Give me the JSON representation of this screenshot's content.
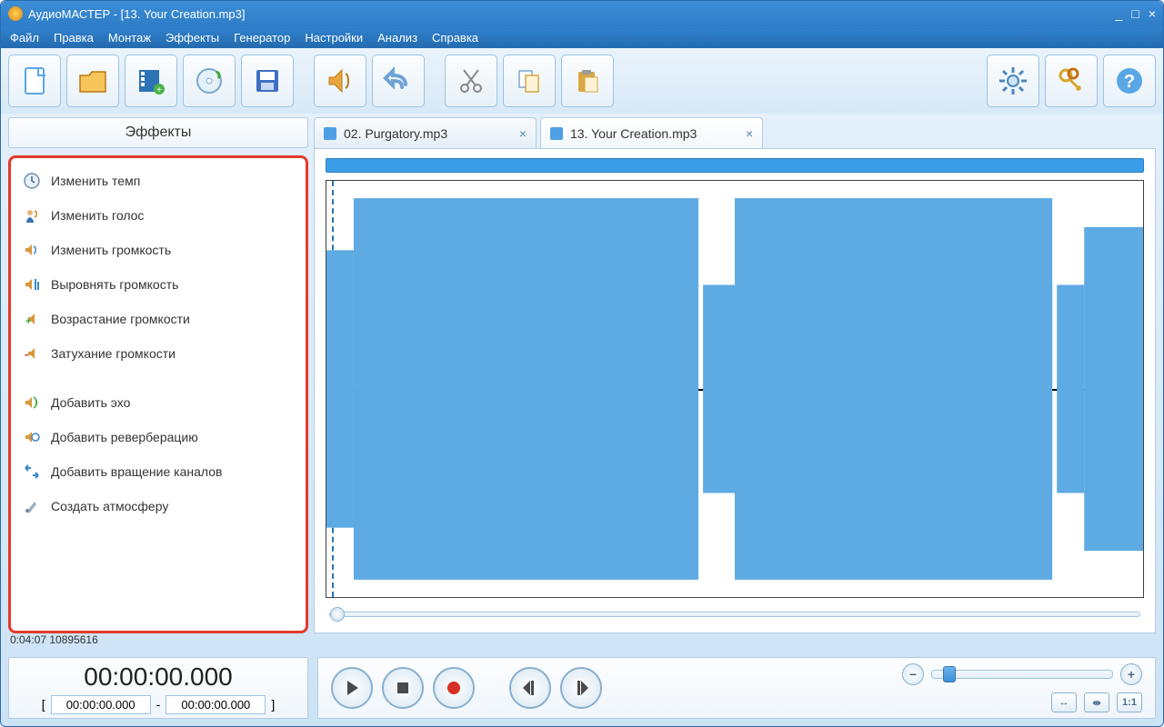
{
  "window": {
    "title": "АудиоМАСТЕР - [13. Your Creation.mp3]"
  },
  "menu": {
    "file": "Файл",
    "edit": "Правка",
    "montage": "Монтаж",
    "effects": "Эффекты",
    "generator": "Генератор",
    "settings": "Настройки",
    "analysis": "Анализ",
    "help": "Справка"
  },
  "toolbar": {
    "new": "new-file",
    "open": "open-folder",
    "import_video": "import-video",
    "import_cd": "import-cd",
    "save": "save",
    "volume_fx": "volume-effects",
    "undo": "undo",
    "cut": "cut",
    "copy": "copy",
    "paste": "paste",
    "prefs": "settings-gear",
    "keys": "keys",
    "help": "help"
  },
  "sidebar": {
    "header": "Эффекты",
    "items": [
      {
        "icon": "clock-icon",
        "label": "Изменить темп"
      },
      {
        "icon": "voice-icon",
        "label": "Изменить голос"
      },
      {
        "icon": "speakervol-icon",
        "label": "Изменить громкость"
      },
      {
        "icon": "levels-icon",
        "label": "Выровнять громкость"
      },
      {
        "icon": "fadein-icon",
        "label": "Возрастание громкости"
      },
      {
        "icon": "fadeout-icon",
        "label": "Затухание громкости"
      }
    ],
    "items2": [
      {
        "icon": "echo-icon",
        "label": "Добавить эхо"
      },
      {
        "icon": "reverb-icon",
        "label": "Добавить реверберацию"
      },
      {
        "icon": "chanrot-icon",
        "label": "Добавить вращение каналов"
      },
      {
        "icon": "atmosphere-icon",
        "label": "Создать атмосферу"
      }
    ]
  },
  "tabs": [
    {
      "label": "02. Purgatory.mp3",
      "active": false
    },
    {
      "label": "13. Your Creation.mp3",
      "active": true
    }
  ],
  "status": {
    "text": "0:04:07 10895616"
  },
  "time": {
    "main": "00:00:00.000",
    "from": "00:00:00.000",
    "to": "00:00:00.000",
    "sep": "-"
  },
  "zoom": {
    "fit_label": "1:1"
  }
}
